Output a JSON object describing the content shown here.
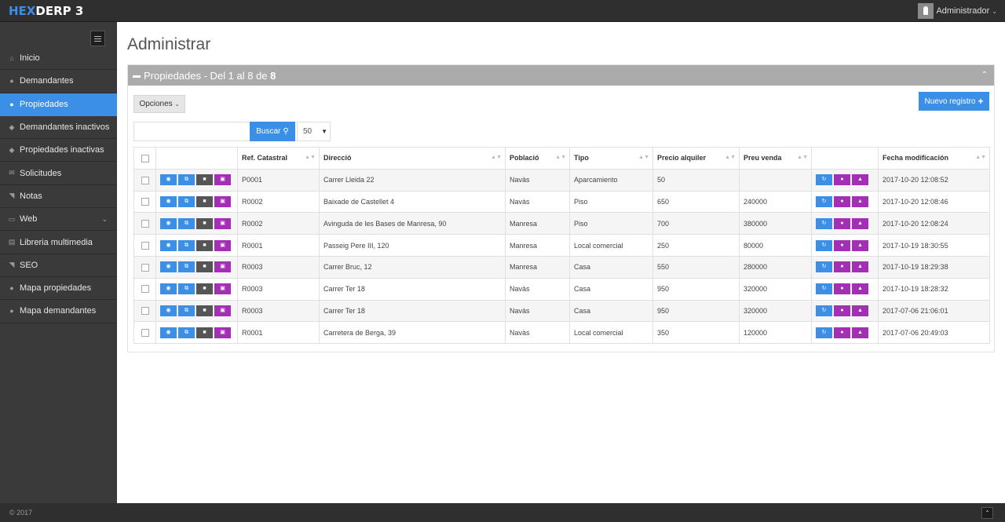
{
  "brand": {
    "part1": "HEX",
    "part2": "DERP 3"
  },
  "user": {
    "name": "Administrador"
  },
  "sidebar": {
    "items": [
      {
        "label": "Inicio",
        "icon": "home-icon",
        "glyph": "⌂"
      },
      {
        "label": "Demandantes",
        "icon": "users-icon",
        "glyph": "●"
      },
      {
        "label": "Propiedades",
        "icon": "map-marker-icon",
        "glyph": "●",
        "active": true
      },
      {
        "label": "Demandantes inactivos",
        "icon": "dropbox-icon",
        "glyph": "◆"
      },
      {
        "label": "Propiedades inactivas",
        "icon": "dropbox-icon",
        "glyph": "◆"
      },
      {
        "label": "Solicitudes",
        "icon": "envelope-icon",
        "glyph": "✉"
      },
      {
        "label": "Notas",
        "icon": "tag-icon",
        "glyph": "◥"
      },
      {
        "label": "Web",
        "icon": "desktop-icon",
        "glyph": "▭",
        "has_chevron": true
      },
      {
        "label": "Libreria multimedia",
        "icon": "file-icon",
        "glyph": "▤"
      },
      {
        "label": "SEO",
        "icon": "tag-icon",
        "glyph": "◥"
      },
      {
        "label": "Mapa propiedades",
        "icon": "globe-icon",
        "glyph": "●"
      },
      {
        "label": "Mapa demandantes",
        "icon": "globe-icon",
        "glyph": "●"
      }
    ]
  },
  "page": {
    "title": "Administrar"
  },
  "panel": {
    "title_prefix": "Propiedades - Del 1 al 8 de ",
    "title_total": "8"
  },
  "toolbar": {
    "options_label": "Opciones",
    "new_label": "Nuevo registro",
    "search_label": "Buscar",
    "search_placeholder": "",
    "per_page": "50"
  },
  "table": {
    "headers": [
      "Ref. Catastral",
      "Direcció",
      "Població",
      "Tipo",
      "Precio alquiler",
      "Preu venda",
      "Fecha modificación"
    ],
    "rows": [
      [
        "P0001",
        "Carrer Lleida 22",
        "Navàs",
        "Aparcamiento",
        "50",
        "",
        "2017-10-20 12:08:52"
      ],
      [
        "R0002",
        "Baixade de Castellet 4",
        "Navàs",
        "Piso",
        "650",
        "240000",
        "2017-10-20 12:08:46"
      ],
      [
        "R0002",
        "Avinguda de les Bases de Manresa, 90",
        "Manresa",
        "Piso",
        "700",
        "380000",
        "2017-10-20 12:08:24"
      ],
      [
        "R0001",
        "Passeig Pere III, 120",
        "Manresa",
        "Local comercial",
        "250",
        "80000",
        "2017-10-19 18:30:55"
      ],
      [
        "R0003",
        "Carrer Bruc, 12",
        "Manresa",
        "Casa",
        "550",
        "280000",
        "2017-10-19 18:29:38"
      ],
      [
        "R0003",
        "Carrer Ter 18",
        "Navàs",
        "Casa",
        "950",
        "320000",
        "2017-10-19 18:28:32"
      ],
      [
        "R0003",
        "Carrer Ter 18",
        "Navàs",
        "Casa",
        "950",
        "320000",
        "2017-07-06 21:06:01"
      ],
      [
        "R0001",
        "Carretera de Berga, 39",
        "Navàs",
        "Local comercial",
        "350",
        "120000",
        "2017-07-06 20:49:03"
      ]
    ]
  },
  "footer": {
    "copyright": "© 2017"
  },
  "colors": {
    "accent": "#3c8fe6",
    "purple": "#a32fb5",
    "sidebar": "#3a3a3a",
    "topbar": "#2f2f2f"
  }
}
